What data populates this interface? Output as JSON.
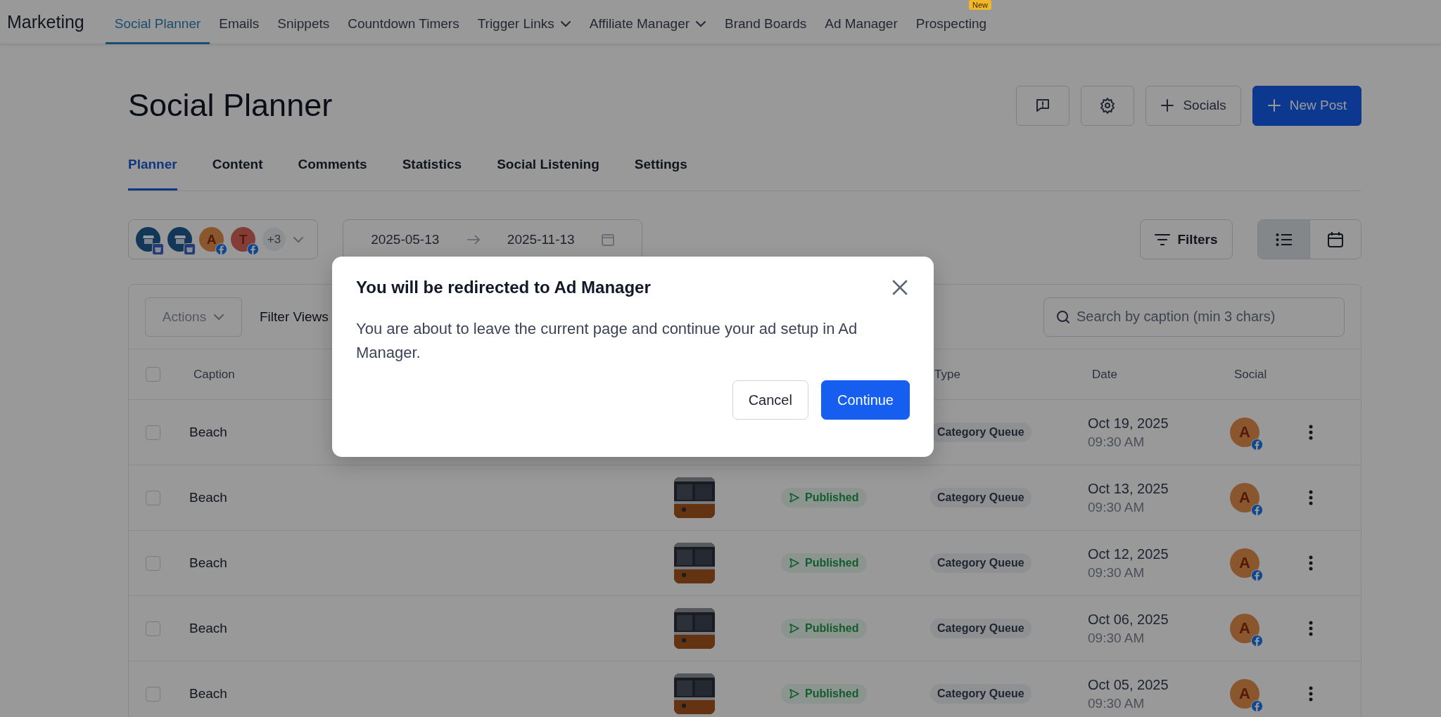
{
  "top_nav": {
    "brand": "Marketing",
    "items": [
      {
        "label": "Social Planner",
        "selected": true,
        "dropdown": false
      },
      {
        "label": "Emails",
        "selected": false,
        "dropdown": false
      },
      {
        "label": "Snippets",
        "selected": false,
        "dropdown": false
      },
      {
        "label": "Countdown Timers",
        "selected": false,
        "dropdown": false
      },
      {
        "label": "Trigger Links",
        "selected": false,
        "dropdown": true
      },
      {
        "label": "Affiliate Manager",
        "selected": false,
        "dropdown": true
      },
      {
        "label": "Brand Boards",
        "selected": false,
        "dropdown": false
      },
      {
        "label": "Ad Manager",
        "selected": false,
        "dropdown": false
      },
      {
        "label": "Prospecting",
        "selected": false,
        "dropdown": false,
        "badge": "New"
      }
    ]
  },
  "page": {
    "title": "Social Planner",
    "actions": [
      {
        "kind": "feedback"
      },
      {
        "kind": "settings"
      },
      {
        "kind": "add",
        "label": "Socials"
      },
      {
        "kind": "primary",
        "label": "New Post"
      }
    ]
  },
  "tabs": [
    {
      "label": "Planner",
      "selected": true
    },
    {
      "label": "Content",
      "selected": false
    },
    {
      "label": "Comments",
      "selected": false
    },
    {
      "label": "Statistics",
      "selected": false
    },
    {
      "label": "Social Listening",
      "selected": false
    },
    {
      "label": "Settings",
      "selected": false
    }
  ],
  "accounts": {
    "items": [
      {
        "kind": "store",
        "color": "#133858"
      },
      {
        "kind": "store",
        "color": "#133858"
      },
      {
        "kind": "letter",
        "letter": "A",
        "color": "#89562e"
      },
      {
        "kind": "letter",
        "letter": "T",
        "color": "#823e37"
      }
    ],
    "more": "+3"
  },
  "date_range": {
    "start": "2025-05-13",
    "end": "2025-11-13"
  },
  "filters_button": "Filters",
  "view_toggle": [
    {
      "kind": "list",
      "selected": true
    },
    {
      "kind": "calendar",
      "selected": false
    }
  ],
  "table": {
    "actions": "Actions",
    "filter_views": "Filter Views",
    "search": {
      "placeholder": "Search by caption (min 3 chars)"
    },
    "select_all": {
      "checked": false
    },
    "columns": [
      {
        "label": "Caption"
      },
      {
        "label": "Type"
      },
      {
        "label": "Date"
      },
      {
        "label": "Social"
      }
    ],
    "rows": [
      {
        "caption": "Beach",
        "checked": false,
        "type": "Category Queue",
        "date": "Oct 19, 2025",
        "time": "09:30 AM",
        "avatar": "A"
      },
      {
        "caption": "Beach",
        "checked": false,
        "status": "Published",
        "type": "Category Queue",
        "date": "Oct 13, 2025",
        "time": "09:30 AM",
        "avatar": "A"
      },
      {
        "caption": "Beach",
        "checked": false,
        "status": "Published",
        "type": "Category Queue",
        "date": "Oct 12, 2025",
        "time": "09:30 AM",
        "avatar": "A"
      },
      {
        "caption": "Beach",
        "checked": false,
        "status": "Published",
        "type": "Category Queue",
        "date": "Oct 06, 2025",
        "time": "09:30 AM",
        "avatar": "A"
      },
      {
        "caption": "Beach",
        "checked": false,
        "status": "Published",
        "type": "Category Queue",
        "date": "Oct 05, 2025",
        "time": "09:30 AM",
        "avatar": "A"
      }
    ]
  },
  "dialog": {
    "title": "You will be redirected to Ad Manager",
    "body": "You are about to leave the current page and continue your ad setup in Ad Manager.",
    "buttons": [
      {
        "kind": "secondary",
        "label": "Cancel"
      },
      {
        "kind": "primary",
        "label": "Continue"
      }
    ]
  }
}
